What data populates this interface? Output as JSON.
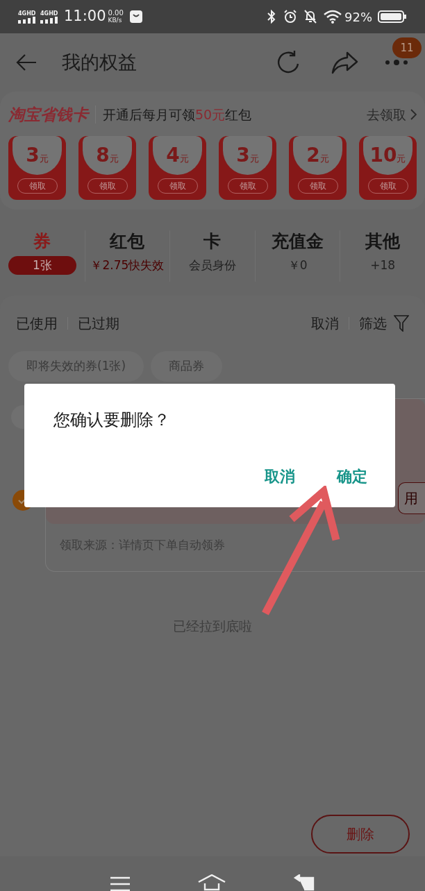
{
  "status_bar": {
    "signals": [
      "4GHD",
      "4GHD"
    ],
    "time": "11:00",
    "speed": "0.00",
    "speed_unit": "KB/s",
    "battery": "92%"
  },
  "header": {
    "title": "我的权益",
    "badge": "11"
  },
  "promo": {
    "brand": "淘宝省钱卡",
    "text_before": "开通后每月可领",
    "highlight": "50元",
    "text_after": "红包",
    "link": "去领取",
    "coupons": [
      {
        "amount": "3",
        "unit": "元",
        "action": "领取"
      },
      {
        "amount": "8",
        "unit": "元",
        "action": "领取"
      },
      {
        "amount": "4",
        "unit": "元",
        "action": "领取"
      },
      {
        "amount": "3",
        "unit": "元",
        "action": "领取"
      },
      {
        "amount": "2",
        "unit": "元",
        "action": "领取"
      },
      {
        "amount": "10",
        "unit": "元",
        "action": "领取"
      }
    ]
  },
  "categories": [
    {
      "title": "券",
      "sub": "1张",
      "selected": true,
      "alert": false
    },
    {
      "title": "红包",
      "sub": "￥2.75快失效",
      "selected": false,
      "alert": true
    },
    {
      "title": "卡",
      "sub": "会员身份",
      "selected": false,
      "alert": false
    },
    {
      "title": "充值金",
      "sub": "￥0",
      "selected": false,
      "alert": false
    },
    {
      "title": "其他",
      "sub": "+18",
      "selected": false,
      "alert": false
    }
  ],
  "toolbar": {
    "left": [
      "已使用",
      "已过期"
    ],
    "cancel": "取消",
    "filter": "筛选"
  },
  "chips": [
    "即将失效的券(1张)",
    "商品券"
  ],
  "coupon_card": {
    "checked": true,
    "action": "用",
    "source": "领取来源：详情页下单自动领券"
  },
  "end_note": "已经拉到底啦",
  "delete_button": "删除",
  "dialog": {
    "message": "您确认要删除？",
    "buttons": [
      "取消",
      "确定"
    ]
  }
}
